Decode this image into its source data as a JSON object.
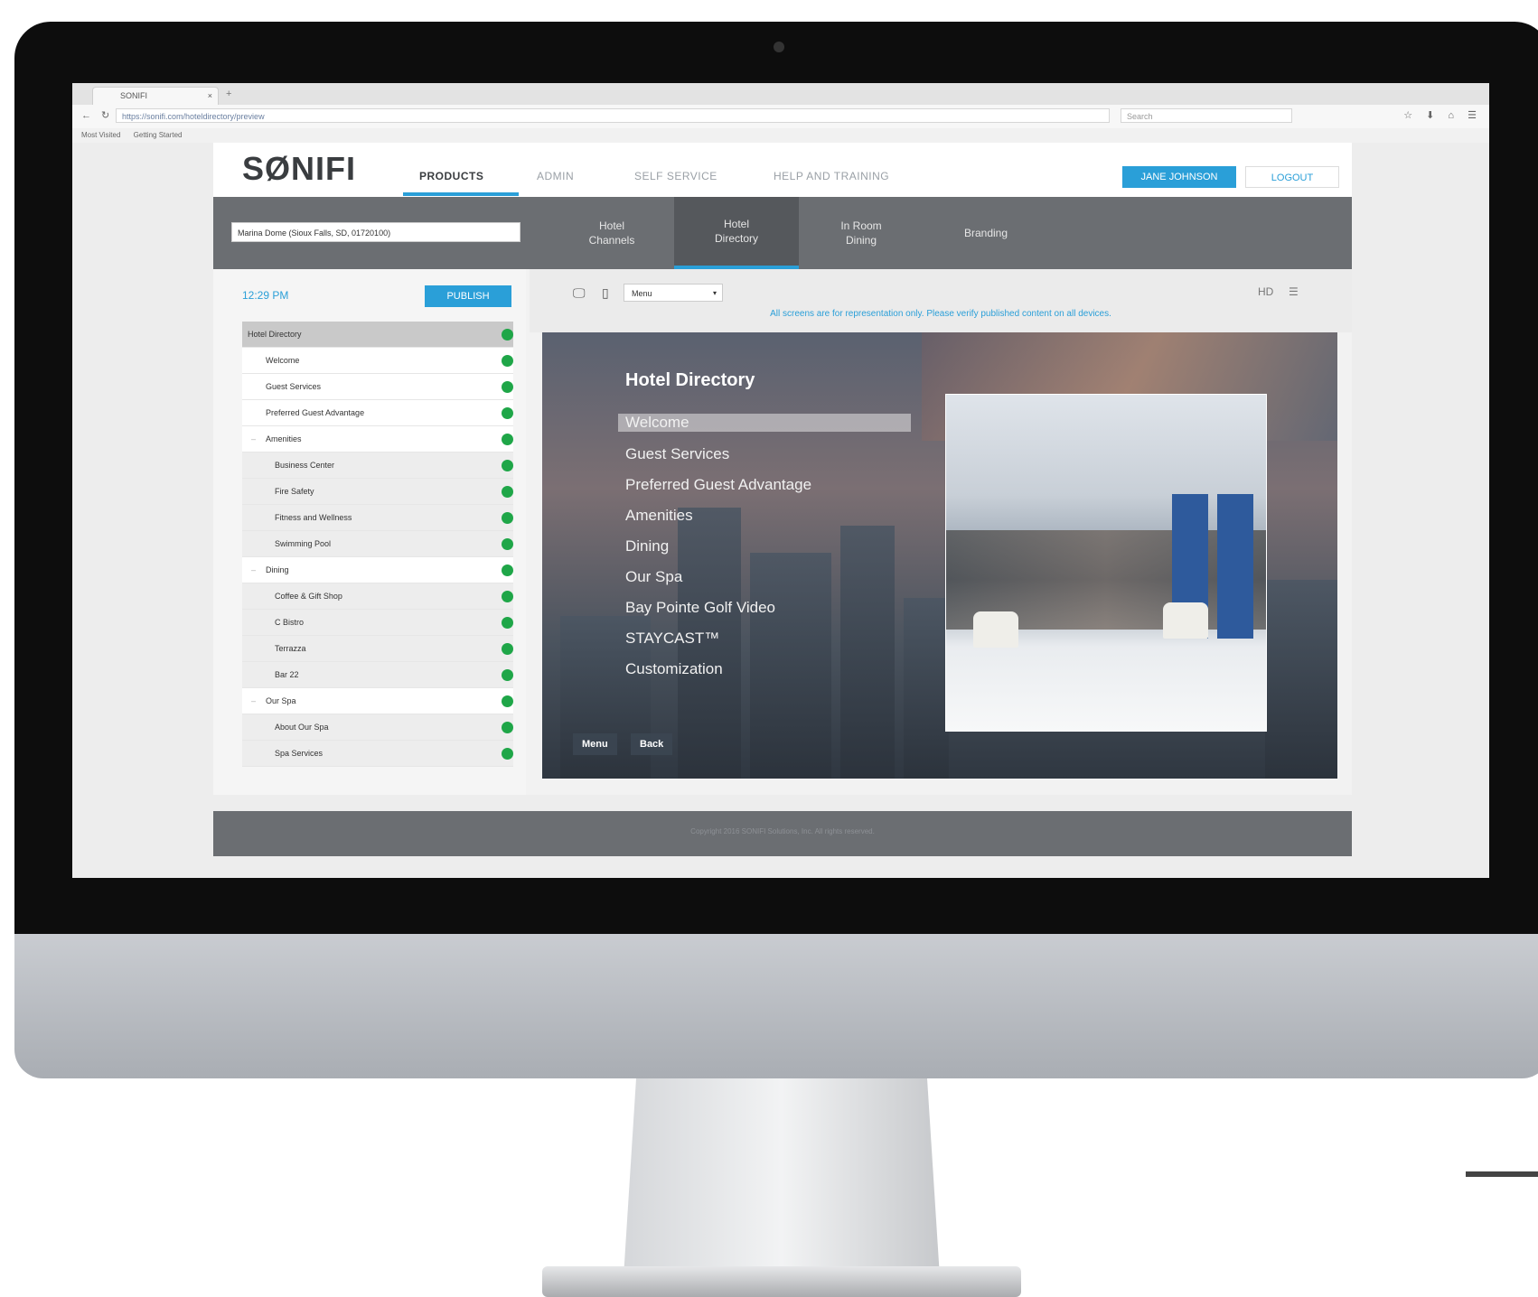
{
  "browser": {
    "tab_title": "SONIFI",
    "tab_close": "×",
    "new_tab": "+",
    "nav_buttons": "← ↻ ⌂",
    "url": "https://sonifi.com/hoteldirectory/preview",
    "search_placeholder": "Search",
    "tool_icons": "☆ ⬇ ⌂ ☰",
    "bookmarks": [
      "Most Visited",
      "Getting Started"
    ]
  },
  "app": {
    "logo": "SØNIFI",
    "nav": [
      "PRODUCTS",
      "ADMIN",
      "SELF SERVICE",
      "HELP AND TRAINING"
    ],
    "user_button": "JANE JOHNSON",
    "logout_button": "LOGOUT",
    "property_selector": "Marina Dome (Sioux Falls, SD, 01720100)",
    "subtabs": [
      "Hotel Channels",
      "Hotel Directory",
      "In Room Dining",
      "Branding"
    ],
    "active_subtab": "Hotel Directory",
    "time": "12:29 PM",
    "publish_button": "PUBLISH",
    "tree": [
      {
        "label": "Hotel Directory",
        "level": 0,
        "toggle": ""
      },
      {
        "label": "Welcome",
        "level": 1,
        "toggle": ""
      },
      {
        "label": "Guest Services",
        "level": 1,
        "toggle": ""
      },
      {
        "label": "Preferred Guest Advantage",
        "level": 1,
        "toggle": ""
      },
      {
        "label": "Amenities",
        "level": 1,
        "toggle": "–"
      },
      {
        "label": "Business Center",
        "level": 2,
        "toggle": ""
      },
      {
        "label": "Fire Safety",
        "level": 2,
        "toggle": ""
      },
      {
        "label": "Fitness and Wellness",
        "level": 2,
        "toggle": ""
      },
      {
        "label": "Swimming Pool",
        "level": 2,
        "toggle": ""
      },
      {
        "label": "Dining",
        "level": 1,
        "toggle": "–"
      },
      {
        "label": "Coffee & Gift Shop",
        "level": 2,
        "toggle": ""
      },
      {
        "label": "C Bistro",
        "level": 2,
        "toggle": ""
      },
      {
        "label": "Terrazza",
        "level": 2,
        "toggle": ""
      },
      {
        "label": "Bar 22",
        "level": 2,
        "toggle": ""
      },
      {
        "label": "Our Spa",
        "level": 1,
        "toggle": "–"
      },
      {
        "label": "About Our Spa",
        "level": 2,
        "toggle": ""
      },
      {
        "label": "Spa Services",
        "level": 2,
        "toggle": ""
      }
    ],
    "status_color": "#1fa648",
    "preview_select": "Menu",
    "preview_select_arrow": "▾",
    "desktop_icon": "🖵",
    "mobile_icon": "▯",
    "hd_label": "HD",
    "list_icon": "☰",
    "notice": "All screens are for representation only. Please verify published content on all devices.",
    "footer": "Copyright 2016 SONIFI Solutions, Inc. All rights reserved.",
    "accent_color": "#2a9fd8"
  },
  "preview": {
    "title": "Hotel Directory",
    "menu": [
      "Welcome",
      "Guest Services",
      "Preferred Guest Advantage",
      "Amenities",
      "Dining",
      "Our Spa",
      "Bay Pointe Golf Video",
      "STAYCAST™",
      "Customization"
    ],
    "selected": "Welcome",
    "menu_button": "Menu",
    "back_button": "Back"
  }
}
